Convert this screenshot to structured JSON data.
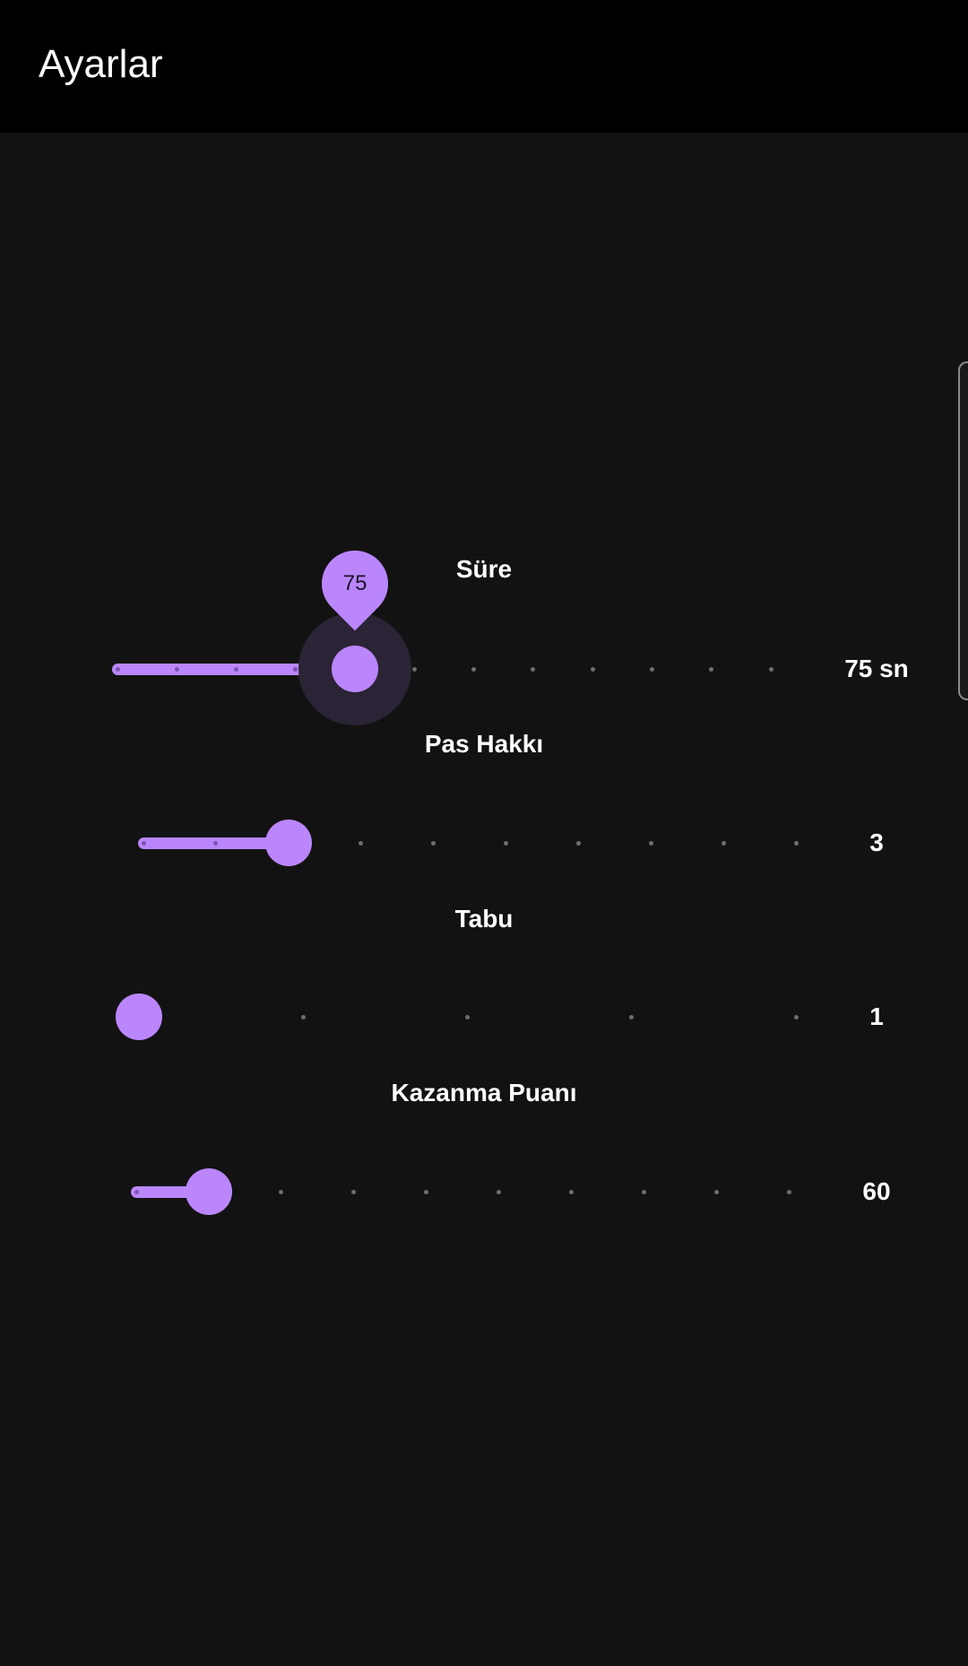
{
  "app_bar": {
    "title": "Ayarlar"
  },
  "colors": {
    "accent": "#bb86fc",
    "background": "#121212",
    "app_bar": "#000000",
    "tick_inactive": "#6e6e6e"
  },
  "settings": [
    {
      "label": "Süre",
      "value_text": "75 sn",
      "indicator": "75",
      "tick_count": 12,
      "selected_index": 4,
      "focused": true
    },
    {
      "label": "Pas Hakkı",
      "value_text": "3",
      "tick_count": 10,
      "selected_index": 2,
      "focused": false
    },
    {
      "label": "Tabu",
      "value_text": "1",
      "tick_count": 5,
      "selected_index": 0,
      "focused": false
    },
    {
      "label": "Kazanma Puanı",
      "value_text": "60",
      "tick_count": 10,
      "selected_index": 1,
      "focused": false
    }
  ]
}
